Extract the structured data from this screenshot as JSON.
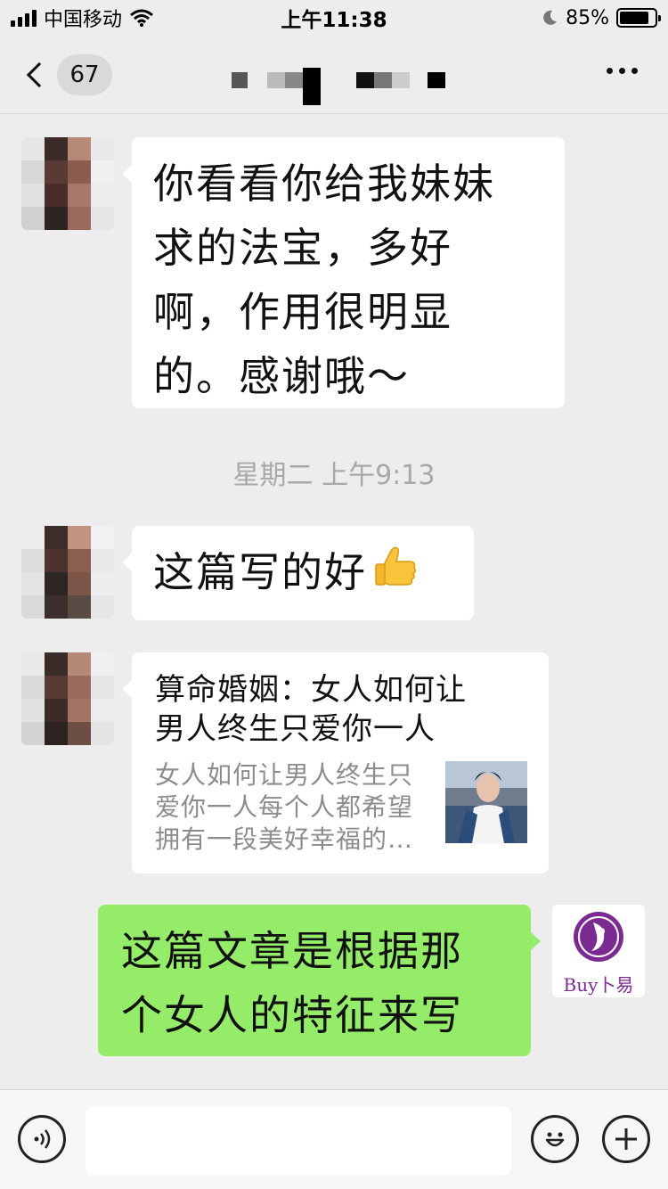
{
  "status_bar": {
    "carrier": "中国移动",
    "time": "上午11:38",
    "battery": "85%",
    "battery_level": 0.85
  },
  "nav": {
    "unread_count": "67"
  },
  "messages": [
    {
      "side": "left",
      "text": "你看看你给我妹妹求的法宝，多好啊，作用很明显的。感谢哦～",
      "lines": [
        "你看看你给我妹妹",
        "求的法宝，多好",
        "啊，作用很明显",
        "的。感谢哦～"
      ]
    },
    {
      "side": "left",
      "text": "这篇写的好",
      "emoji": "thumbs-up"
    },
    {
      "side": "left",
      "type": "link",
      "title_lines": [
        "算命婚姻：女人如何让",
        "男人终生只爱你一人"
      ],
      "desc_lines": [
        "女人如何让男人终生只",
        "爱你一人每个人都希望",
        "拥有一段美好幸福的…"
      ]
    },
    {
      "side": "right",
      "lines": [
        "这篇文章是根据那",
        "个女人的特征来写"
      ]
    }
  ],
  "timestamp": "星期二 上午9:13",
  "logo": {
    "text": "Buy卜易",
    "color": "#7a2a90"
  },
  "colors": {
    "sent_bubble": "#95ec69",
    "received_bubble": "#ffffff",
    "background": "#ededed"
  },
  "input": {
    "value": "",
    "placeholder": ""
  }
}
